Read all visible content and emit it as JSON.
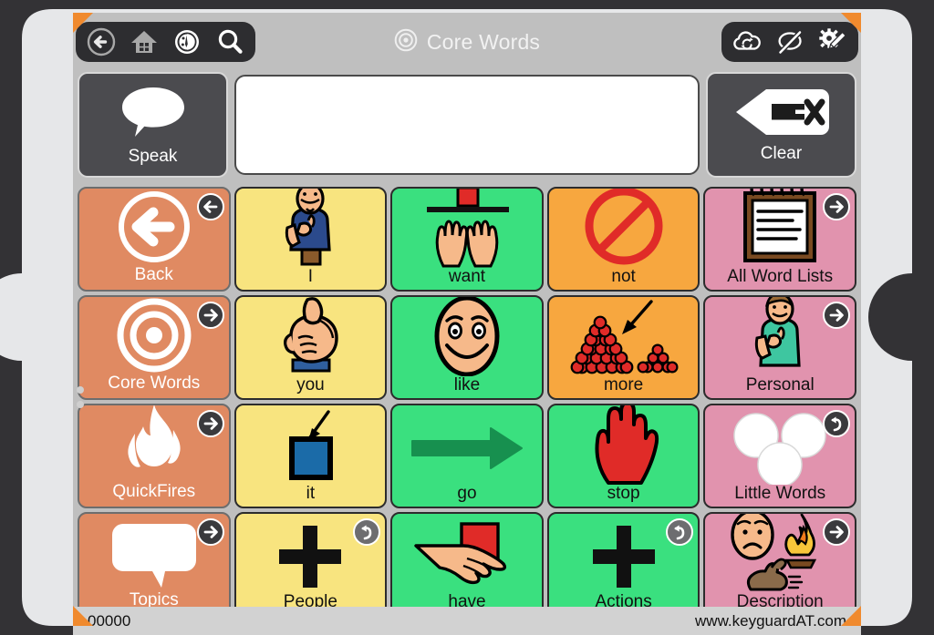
{
  "app": {
    "title": "Core Words",
    "title_icon": "target-icon"
  },
  "toolbar_left": [
    {
      "name": "back-icon",
      "label": "Back"
    },
    {
      "name": "home-icon",
      "label": "Home"
    },
    {
      "name": "dashboard-icon",
      "label": "Dashboard"
    },
    {
      "name": "search-icon",
      "label": "Search"
    }
  ],
  "toolbar_right": [
    {
      "name": "cloud-sync-icon",
      "label": "Sync"
    },
    {
      "name": "speech-muted-icon",
      "label": "Mute Speech"
    },
    {
      "name": "edit-gear-pencil-icon",
      "label": "Edit"
    }
  ],
  "message_bar": {
    "speak_label": "Speak",
    "speak_icon": "speech-bubble-icon",
    "clear_label": "Clear",
    "clear_icon": "backspace-clear-icon",
    "message_value": "",
    "message_placeholder": ""
  },
  "grid": {
    "rows": 4,
    "cols": 5,
    "cells": [
      {
        "label": "Back",
        "art": "circle-arrow-left",
        "bg": "#e08a62",
        "type": "nav",
        "badge": "arrow-left",
        "badge_style": "dark"
      },
      {
        "label": "I",
        "art": "person-point-self",
        "bg": "#f8e47f",
        "type": "word",
        "badge": null,
        "badge_style": null
      },
      {
        "label": "want",
        "art": "hands-reach-shelf",
        "bg": "#3ae07f",
        "type": "word",
        "badge": null,
        "badge_style": null
      },
      {
        "label": "not",
        "art": "prohibition-sign",
        "bg": "#f7a73f",
        "type": "word",
        "badge": null,
        "badge_style": null
      },
      {
        "label": "All Word Lists",
        "art": "notepad",
        "bg": "#e193ae",
        "type": "nav2",
        "badge": "arrow-right",
        "badge_style": "dark"
      },
      {
        "label": "Core Words",
        "art": "target-rings",
        "bg": "#e08a62",
        "type": "nav",
        "badge": "arrow-right",
        "badge_style": "dark"
      },
      {
        "label": "you",
        "art": "pointing-fist",
        "bg": "#f8e47f",
        "type": "word",
        "badge": null,
        "badge_style": null
      },
      {
        "label": "like",
        "art": "smiling-face",
        "bg": "#3ae07f",
        "type": "word",
        "badge": null,
        "badge_style": null
      },
      {
        "label": "more",
        "art": "two-piles-arrow",
        "bg": "#f7a73f",
        "type": "word",
        "badge": null,
        "badge_style": null
      },
      {
        "label": "Personal",
        "art": "person-point-self-green",
        "bg": "#e193ae",
        "type": "nav2",
        "badge": "arrow-right",
        "badge_style": "dark"
      },
      {
        "label": "QuickFires",
        "art": "flame",
        "bg": "#e08a62",
        "type": "nav",
        "badge": "arrow-right",
        "badge_style": "dark"
      },
      {
        "label": "it",
        "art": "blue-square-arrow",
        "bg": "#f8e47f",
        "type": "word",
        "badge": null,
        "badge_style": null
      },
      {
        "label": "go",
        "art": "right-arrow-green",
        "bg": "#3ae07f",
        "type": "word",
        "badge": null,
        "badge_style": null
      },
      {
        "label": "stop",
        "art": "red-hand",
        "bg": "#3ae07f",
        "type": "word",
        "badge": null,
        "badge_style": null
      },
      {
        "label": "Little Words",
        "art": "three-circles",
        "bg": "#e193ae",
        "type": "nav2",
        "badge": "arrow-back-curve",
        "badge_style": "dark"
      },
      {
        "label": "Topics",
        "art": "speech-bubble-white",
        "bg": "#e08a62",
        "type": "nav",
        "badge": "arrow-right",
        "badge_style": "dark"
      },
      {
        "label": "People",
        "art": "plus-sign",
        "bg": "#f8e47f",
        "type": "word",
        "badge": "arrow-back-curve",
        "badge_style": "gray"
      },
      {
        "label": "have",
        "art": "hand-red-block",
        "bg": "#3ae07f",
        "type": "word",
        "badge": null,
        "badge_style": null
      },
      {
        "label": "Actions",
        "art": "plus-sign",
        "bg": "#3ae07f",
        "type": "word",
        "badge": "arrow-back-curve",
        "badge_style": "gray"
      },
      {
        "label": "Description",
        "art": "face-fire-rabbit",
        "bg": "#e193ae",
        "type": "nav2",
        "badge": "arrow-right",
        "badge_style": "dark"
      }
    ]
  },
  "status_bar": {
    "left_text": "00000",
    "right_text": "www.keyguardAT.com"
  },
  "colors": {
    "nav_orange": "#e08a62",
    "word_yellow": "#f8e47f",
    "word_green": "#3ae07f",
    "word_orange": "#f7a73f",
    "list_pink": "#e193ae",
    "keyguard": "#e6e7e9",
    "keyguard_accent": "#f08a2e",
    "chrome_dark": "#2d2d30",
    "app_bg": "#bfbfbf"
  }
}
